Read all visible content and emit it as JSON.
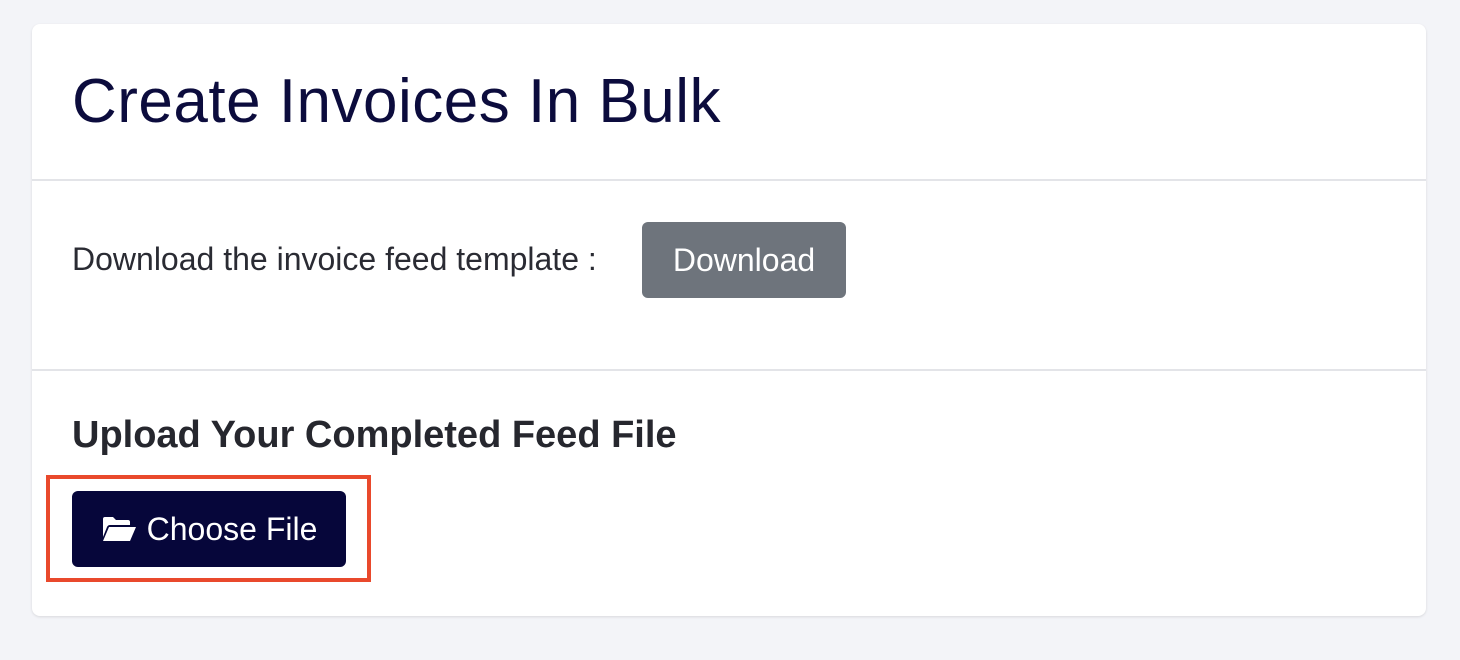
{
  "card": {
    "title": "Create Invoices In Bulk"
  },
  "download_section": {
    "label": "Download the invoice feed template :",
    "button_label": "Download"
  },
  "upload_section": {
    "title": "Upload Your Completed Feed File",
    "button_label": "Choose File",
    "button_icon": "folder-open-icon"
  },
  "colors": {
    "page_background": "#f3f4f8",
    "title_color": "#0c0c3d",
    "download_button": "#6e747c",
    "choose_file_button": "#06063a",
    "highlight_border": "#e9492c"
  }
}
